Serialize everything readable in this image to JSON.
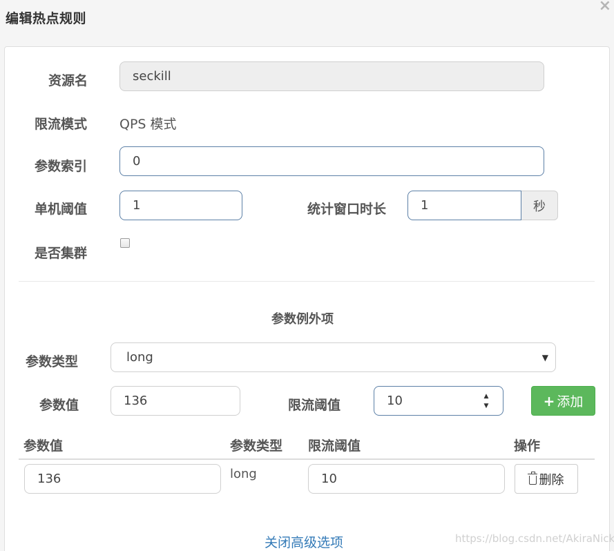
{
  "dialog": {
    "title": "编辑热点规则",
    "close_glyph": "×"
  },
  "form": {
    "resource_label": "资源名",
    "resource_value": "seckill",
    "mode_label": "限流模式",
    "mode_value": "QPS 模式",
    "param_index_label": "参数索引",
    "param_index_value": "0",
    "threshold_label": "单机阈值",
    "threshold_value": "1",
    "window_label": "统计窗口时长",
    "window_value": "1",
    "window_unit": "秒",
    "cluster_label": "是否集群",
    "cluster_checked": false
  },
  "exceptions": {
    "section_title": "参数例外项",
    "type_label": "参数类型",
    "type_selected": "long",
    "value_label": "参数值",
    "value_input": "136",
    "limit_label": "限流阈值",
    "limit_input": "10",
    "add_button": "添加",
    "table": {
      "headers": [
        "参数值",
        "参数类型",
        "限流阈值",
        "操作"
      ],
      "rows": [
        {
          "value": "136",
          "type": "long",
          "limit": "10",
          "action": "删除"
        }
      ]
    }
  },
  "footer": {
    "toggle_link": "关闭高级选项",
    "watermark": "https://blog.csdn.net/AkiraNicky"
  },
  "colors": {
    "accent_link": "#337ab7",
    "add_button": "#5cb85c",
    "input_border_focus": "#5b7fa6"
  },
  "icons": {
    "close": "close-icon",
    "select": "chevron-down-icon",
    "spinner": "spinner-icon",
    "add": "plus-icon",
    "delete": "trash-icon"
  }
}
